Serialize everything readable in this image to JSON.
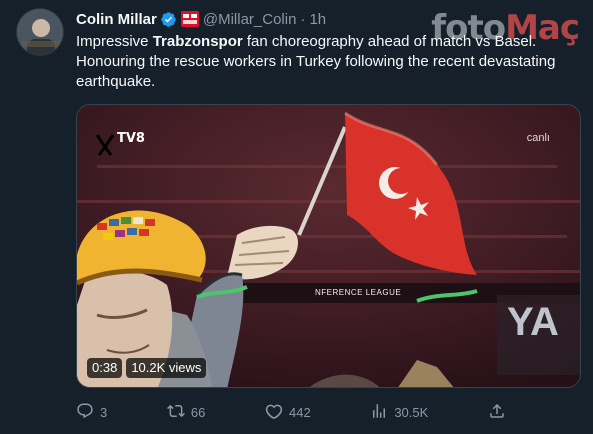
{
  "tweet": {
    "author_name": "Colin Millar",
    "handle": "@Millar_Colin",
    "separator": "·",
    "time": "1h",
    "text_before": "Impressive ",
    "text_bold": "Trabzonspor",
    "text_after": " fan choreography ahead of match vs Basel. Honouring the rescue workers in Turkey following the recent devastating earthquake."
  },
  "watermark": {
    "part1": "foto",
    "part2": "Maç"
  },
  "media": {
    "duration": "0:38",
    "views": "10.2K views",
    "channel_logo": "TV8",
    "live_label": "canlı",
    "banner_text": "NFERENCE LEAGUE"
  },
  "actions": {
    "replies": "3",
    "retweets": "66",
    "likes": "442",
    "views": "30.5K"
  },
  "icons": {
    "reply": "reply-icon",
    "retweet": "retweet-icon",
    "like": "heart-icon",
    "views": "analytics-icon",
    "share": "share-icon"
  },
  "colors": {
    "background": "#15202b",
    "muted": "#8b98a5",
    "verified": "#1d9bf0"
  }
}
